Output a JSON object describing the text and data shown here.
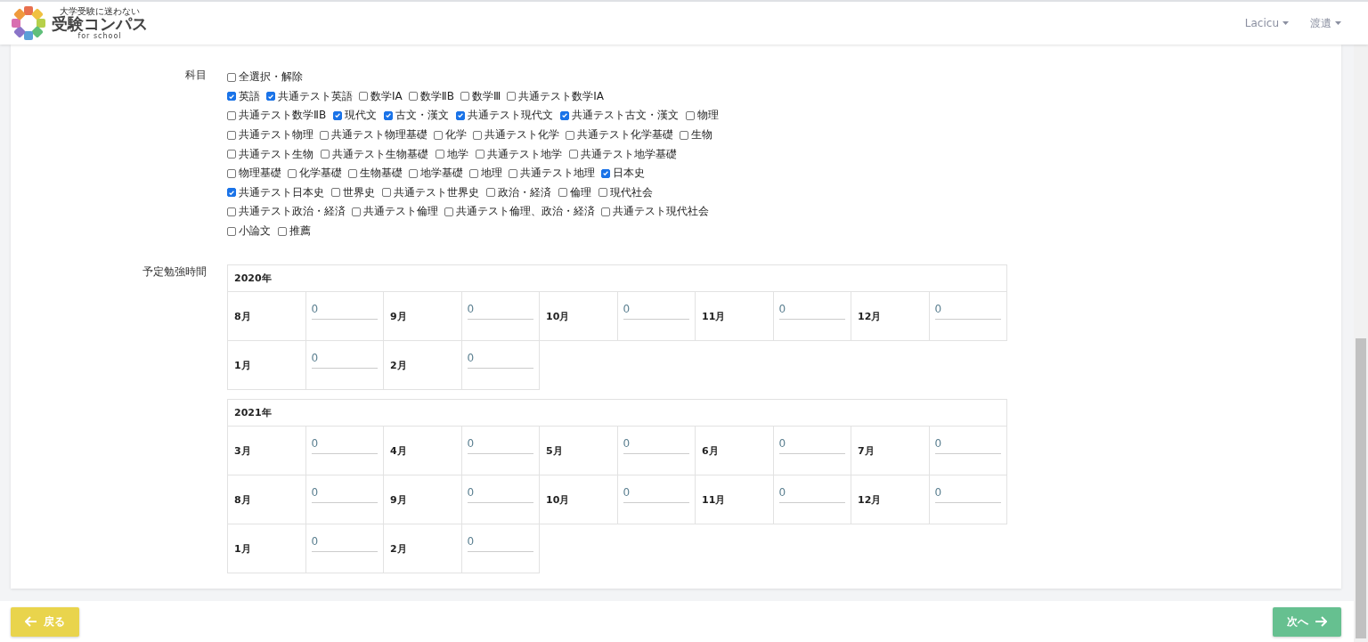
{
  "header": {
    "logo_tagline": "大学受験に迷わない",
    "logo_title": "受験コンパス",
    "logo_sub": "for school",
    "menus": [
      "Lacicu",
      "渡遺"
    ]
  },
  "subjects": {
    "label": "科目",
    "lines": [
      {
        "options": [
          {
            "label": "全選択・解除",
            "checked": false
          }
        ]
      },
      {
        "options": [
          {
            "label": "英語",
            "checked": true
          },
          {
            "label": "共通テスト英語",
            "checked": true
          },
          {
            "label": "数学ⅠA",
            "checked": false
          },
          {
            "label": "数学ⅡB",
            "checked": false
          },
          {
            "label": "数学Ⅲ",
            "checked": false
          },
          {
            "label": "共通テスト数学ⅠA",
            "checked": false
          }
        ]
      },
      {
        "options": [
          {
            "label": "共通テスト数学ⅡB",
            "checked": false
          },
          {
            "label": "現代文",
            "checked": true
          },
          {
            "label": "古文・漢文",
            "checked": true
          },
          {
            "label": "共通テスト現代文",
            "checked": true
          },
          {
            "label": "共通テスト古文・漢文",
            "checked": true
          },
          {
            "label": "物理",
            "checked": false
          }
        ]
      },
      {
        "options": [
          {
            "label": "共通テスト物理",
            "checked": false
          },
          {
            "label": "共通テスト物理基礎",
            "checked": false
          },
          {
            "label": "化学",
            "checked": false
          },
          {
            "label": "共通テスト化学",
            "checked": false
          },
          {
            "label": "共通テスト化学基礎",
            "checked": false
          },
          {
            "label": "生物",
            "checked": false
          }
        ]
      },
      {
        "options": [
          {
            "label": "共通テスト生物",
            "checked": false
          },
          {
            "label": "共通テスト生物基礎",
            "checked": false
          },
          {
            "label": "地学",
            "checked": false
          },
          {
            "label": "共通テスト地学",
            "checked": false
          },
          {
            "label": "共通テスト地学基礎",
            "checked": false
          }
        ]
      },
      {
        "options": [
          {
            "label": "物理基礎",
            "checked": false
          },
          {
            "label": "化学基礎",
            "checked": false
          },
          {
            "label": "生物基礎",
            "checked": false
          },
          {
            "label": "地学基礎",
            "checked": false
          },
          {
            "label": "地理",
            "checked": false
          },
          {
            "label": "共通テスト地理",
            "checked": false
          },
          {
            "label": "日本史",
            "checked": true
          }
        ]
      },
      {
        "options": [
          {
            "label": "共通テスト日本史",
            "checked": true
          },
          {
            "label": "世界史",
            "checked": false
          },
          {
            "label": "共通テスト世界史",
            "checked": false
          },
          {
            "label": "政治・経済",
            "checked": false
          },
          {
            "label": "倫理",
            "checked": false
          },
          {
            "label": "現代社会",
            "checked": false
          }
        ]
      },
      {
        "options": [
          {
            "label": "共通テスト政治・経済",
            "checked": false
          },
          {
            "label": "共通テスト倫理",
            "checked": false
          },
          {
            "label": "共通テスト倫理、政治・経済",
            "checked": false
          },
          {
            "label": "共通テスト現代社会",
            "checked": false
          }
        ]
      },
      {
        "options": [
          {
            "label": "小論文",
            "checked": false
          },
          {
            "label": "推薦",
            "checked": false
          }
        ]
      }
    ]
  },
  "study_hours": {
    "label": "予定勉強時間",
    "years": [
      {
        "year": "2020年",
        "rows": [
          [
            {
              "month": "8月",
              "value": "0"
            },
            {
              "month": "9月",
              "value": "0"
            },
            {
              "month": "10月",
              "value": "0"
            },
            {
              "month": "11月",
              "value": "0"
            },
            {
              "month": "12月",
              "value": "0"
            }
          ],
          [
            {
              "month": "1月",
              "value": "0"
            },
            {
              "month": "2月",
              "value": "0"
            }
          ]
        ]
      },
      {
        "year": "2021年",
        "rows": [
          [
            {
              "month": "3月",
              "value": "0"
            },
            {
              "month": "4月",
              "value": "0"
            },
            {
              "month": "5月",
              "value": "0"
            },
            {
              "month": "6月",
              "value": "0"
            },
            {
              "month": "7月",
              "value": "0"
            }
          ],
          [
            {
              "month": "8月",
              "value": "0"
            },
            {
              "month": "9月",
              "value": "0"
            },
            {
              "month": "10月",
              "value": "0"
            },
            {
              "month": "11月",
              "value": "0"
            },
            {
              "month": "12月",
              "value": "0"
            }
          ],
          [
            {
              "month": "1月",
              "value": "0"
            },
            {
              "month": "2月",
              "value": "0"
            }
          ]
        ]
      }
    ]
  },
  "footer": {
    "back": "戻る",
    "next": "次へ"
  }
}
